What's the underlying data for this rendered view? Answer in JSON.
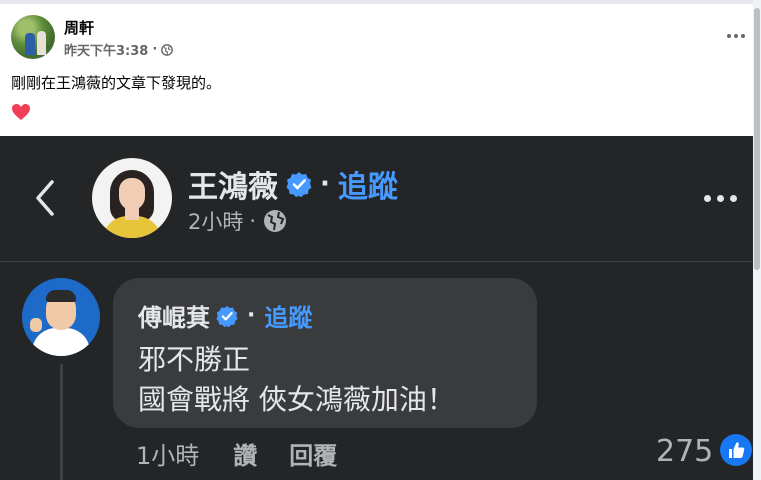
{
  "post": {
    "author": "周軒",
    "time": "昨天下午3:38",
    "meta_sep": "·",
    "text": "剛剛在王鴻薇的文章下發現的。",
    "reaction_icon": "heart-icon",
    "heart_color": "#f33e58"
  },
  "embedded": {
    "page_name": "王鴻薇",
    "follow_label": "追蹤",
    "separator": "·",
    "time": "2小時",
    "comment": {
      "author": "傅崐萁",
      "follow_label": "追蹤",
      "lines": [
        "邪不勝正",
        "國會戰將 俠女鴻薇加油！"
      ],
      "time": "1小時",
      "like_label": "讚",
      "reply_label": "回覆",
      "like_count": "275"
    }
  },
  "colors": {
    "dark_bg": "#242526",
    "bubble_bg": "#3a3b3c",
    "link_blue": "#4599ff",
    "verified_blue": "#1877f2"
  }
}
